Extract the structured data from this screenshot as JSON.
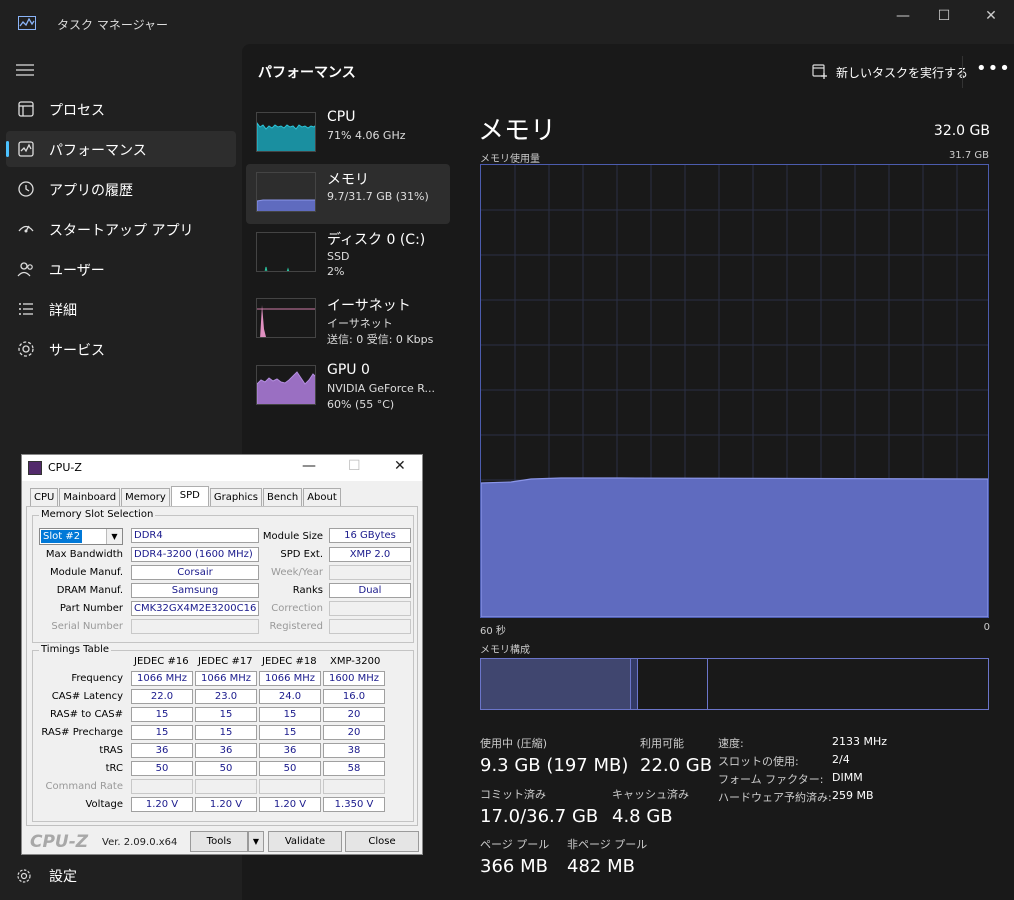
{
  "window": {
    "title": "タスク マネージャー",
    "minimize": "—",
    "maximize": "☐",
    "close": "✕"
  },
  "sidebar": {
    "items": [
      {
        "label": "プロセス",
        "icon": "processes-icon"
      },
      {
        "label": "パフォーマンス",
        "icon": "performance-icon"
      },
      {
        "label": "アプリの履歴",
        "icon": "history-icon"
      },
      {
        "label": "スタートアップ アプリ",
        "icon": "startup-icon"
      },
      {
        "label": "ユーザー",
        "icon": "users-icon"
      },
      {
        "label": "詳細",
        "icon": "details-icon"
      },
      {
        "label": "サービス",
        "icon": "services-icon"
      }
    ],
    "settings": "設定"
  },
  "header": {
    "title": "パフォーマンス",
    "new_task": "新しいタスクを実行する",
    "more": "•••"
  },
  "perf_list": [
    {
      "name": "CPU",
      "line1": "71%  4.06 GHz",
      "line2": ""
    },
    {
      "name": "メモリ",
      "line1": "9.7/31.7 GB (31%)",
      "line2": ""
    },
    {
      "name": "ディスク 0 (C:)",
      "line1": "SSD",
      "line2": "2%"
    },
    {
      "name": "イーサネット",
      "line1": "イーサネット",
      "line2": "送信: 0 受信: 0 Kbps"
    },
    {
      "name": "GPU 0",
      "line1": "NVIDIA GeForce R...",
      "line2": "60%  (55 °C)"
    }
  ],
  "memory": {
    "title": "メモリ",
    "total": "32.0 GB",
    "usage_label": "メモリ使用量",
    "usage_max": "31.7 GB",
    "time_left": "60 秒",
    "time_right": "0",
    "usage_fraction": 0.31,
    "composition_label": "メモリ構成",
    "stats": {
      "in_use_label": "使用中 (圧縮)",
      "in_use_value": "9.3 GB (197 MB)",
      "available_label": "利用可能",
      "available_value": "22.0 GB",
      "committed_label": "コミット済み",
      "committed_value": "17.0/36.7 GB",
      "cached_label": "キャッシュ済み",
      "cached_value": "4.8 GB",
      "paged_label": "ページ プール",
      "paged_value": "366 MB",
      "nonpaged_label": "非ページ プール",
      "nonpaged_value": "482 MB"
    },
    "details": {
      "speed_k": "速度:",
      "speed_v": "2133 MHz",
      "slots_k": "スロットの使用:",
      "slots_v": "2/4",
      "form_k": "フォーム ファクター:",
      "form_v": "DIMM",
      "reserved_k": "ハードウェア予約済み:",
      "reserved_v": "259 MB"
    }
  },
  "cpuz": {
    "title": "CPU-Z",
    "tabs": [
      "CPU",
      "Mainboard",
      "Memory",
      "SPD",
      "Graphics",
      "Bench",
      "About"
    ],
    "slot_group": "Memory Slot Selection",
    "slot": "Slot #2",
    "type": "DDR4",
    "labels": {
      "module_size": "Module Size",
      "max_bw": "Max Bandwidth",
      "spd_ext": "SPD Ext.",
      "manuf": "Module Manuf.",
      "week": "Week/Year",
      "dram": "DRAM Manuf.",
      "ranks": "Ranks",
      "part": "Part Number",
      "correction": "Correction",
      "serial": "Serial Number",
      "registered": "Registered"
    },
    "values": {
      "module_size": "16 GBytes",
      "max_bw": "DDR4-3200 (1600 MHz)",
      "spd_ext": "XMP 2.0",
      "manuf": "Corsair",
      "dram": "Samsung",
      "ranks": "Dual",
      "part": "CMK32GX4M2E3200C16"
    },
    "timings_group": "Timings Table",
    "columns": [
      "JEDEC #16",
      "JEDEC #17",
      "JEDEC #18",
      "XMP-3200"
    ],
    "rows": [
      {
        "label": "Frequency",
        "vals": [
          "1066 MHz",
          "1066 MHz",
          "1066 MHz",
          "1600 MHz"
        ]
      },
      {
        "label": "CAS# Latency",
        "vals": [
          "22.0",
          "23.0",
          "24.0",
          "16.0"
        ]
      },
      {
        "label": "RAS# to CAS#",
        "vals": [
          "15",
          "15",
          "15",
          "20"
        ]
      },
      {
        "label": "RAS# Precharge",
        "vals": [
          "15",
          "15",
          "15",
          "20"
        ]
      },
      {
        "label": "tRAS",
        "vals": [
          "36",
          "36",
          "36",
          "38"
        ]
      },
      {
        "label": "tRC",
        "vals": [
          "50",
          "50",
          "50",
          "58"
        ]
      },
      {
        "label": "Command Rate",
        "vals": [
          "",
          "",
          "",
          ""
        ]
      },
      {
        "label": "Voltage",
        "vals": [
          "1.20 V",
          "1.20 V",
          "1.20 V",
          "1.350 V"
        ]
      }
    ],
    "brand": "CPU-Z",
    "version": "Ver. 2.09.0.x64",
    "tools": "Tools",
    "validate": "Validate",
    "close": "Close"
  },
  "colors": {
    "accent": "#4cc2ff",
    "memory_fill": "#5f6bbf",
    "memory_line": "#8a95e8"
  }
}
